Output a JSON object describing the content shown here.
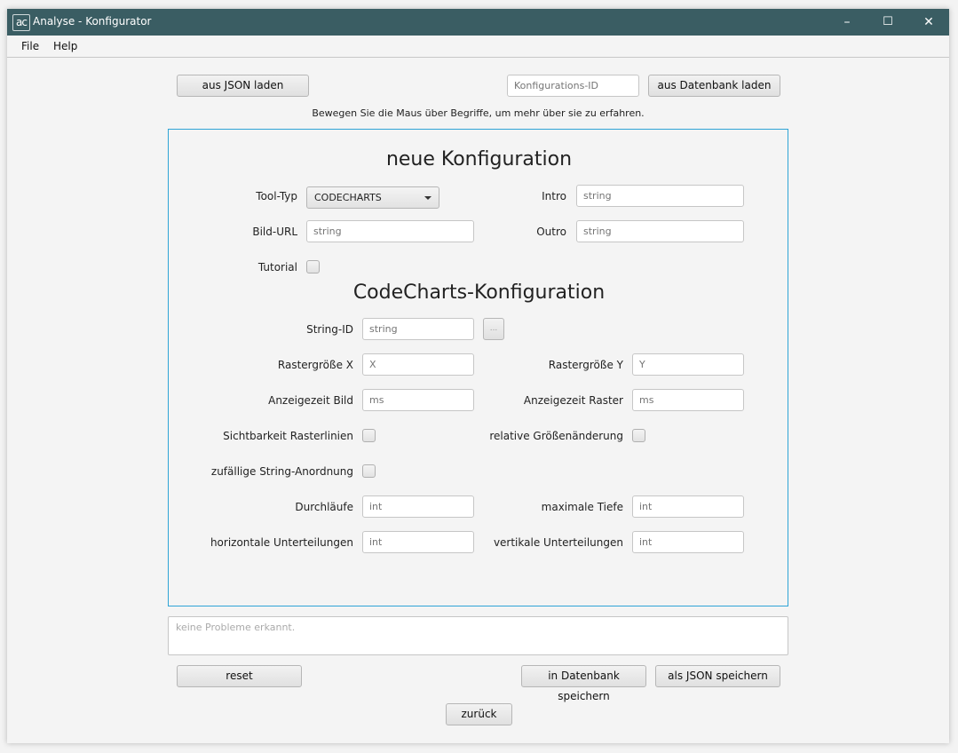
{
  "window": {
    "logo_text": "ac",
    "title": "Analyse - Konfigurator",
    "minimize": "–",
    "maximize": "☐",
    "close": "✕"
  },
  "menu": {
    "file": "File",
    "help": "Help"
  },
  "top": {
    "load_json": "aus JSON laden",
    "config_id_placeholder": "Konfigurations-ID",
    "load_db": "aus Datenbank laden",
    "hint": "Bewegen Sie die Maus über Begriffe, um mehr über sie zu erfahren."
  },
  "general": {
    "heading": "neue Konfiguration",
    "tool_type_label": "Tool-Typ",
    "tool_type_value": "CODECHARTS",
    "intro_label": "Intro",
    "intro_placeholder": "string",
    "image_url_label": "Bild-URL",
    "image_url_placeholder": "string",
    "outro_label": "Outro",
    "outro_placeholder": "string",
    "tutorial_label": "Tutorial"
  },
  "codecharts": {
    "heading": "CodeCharts-Konfiguration",
    "string_id_label": "String-ID",
    "string_id_placeholder": "string",
    "browse": "...",
    "grid_x_label": "Rastergröße X",
    "grid_x_placeholder": "X",
    "grid_y_label": "Rastergröße Y",
    "grid_y_placeholder": "Y",
    "display_image_label": "Anzeigezeit Bild",
    "display_image_placeholder": "ms",
    "display_grid_label": "Anzeigezeit Raster",
    "display_grid_placeholder": "ms",
    "grid_lines_label": "Sichtbarkeit Rasterlinien",
    "relative_resize_label": "relative Größenänderung",
    "random_order_label": "zufällige String-Anordnung",
    "iterations_label": "Durchläufe",
    "iterations_placeholder": "int",
    "max_depth_label": "maximale Tiefe",
    "max_depth_placeholder": "int",
    "horizontal_div_label": "horizontale Unterteilungen",
    "horizontal_div_placeholder": "int",
    "vertical_div_label": "vertikale Unterteilungen",
    "vertical_div_placeholder": "int"
  },
  "status": {
    "placeholder": "keine Probleme erkannt."
  },
  "bottom": {
    "reset": "reset",
    "save_db": "in Datenbank speichern",
    "save_json": "als JSON speichern",
    "back": "zurück"
  },
  "colors": {
    "titlebar": "#3a5d63",
    "panel_border": "#2fa4d6"
  }
}
